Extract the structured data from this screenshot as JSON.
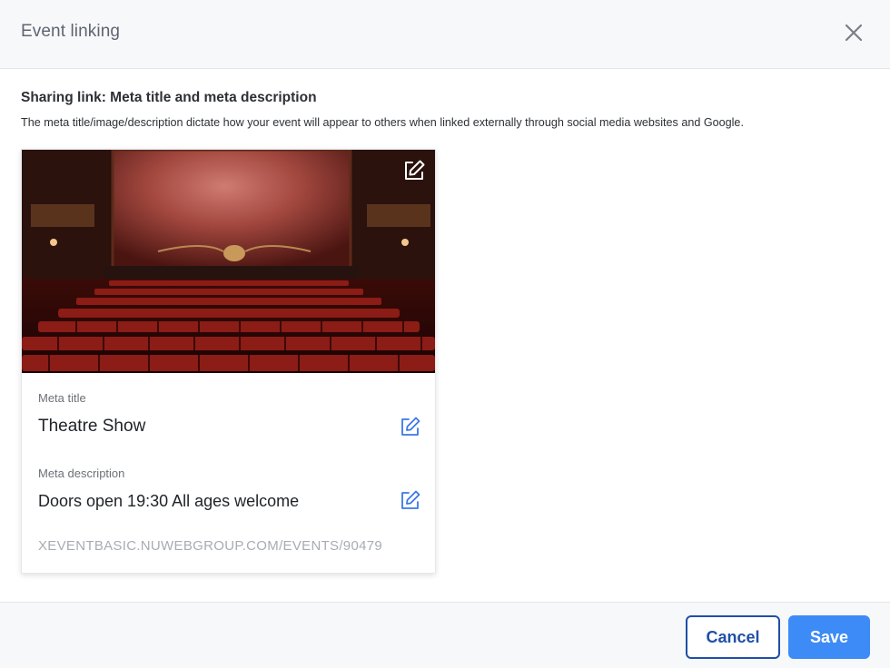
{
  "header": {
    "title": "Event linking",
    "close_icon": "close-icon"
  },
  "section": {
    "title": "Sharing link: Meta title and meta description",
    "description": "The meta title/image/description dictate how your event will appear to others when linked externally through social media websites and Google."
  },
  "card": {
    "image_description": "theatre-auditorium-photo",
    "image_edit_icon": "edit-icon",
    "meta_title_label": "Meta title",
    "meta_title_value": "Theatre Show",
    "meta_description_label": "Meta description",
    "meta_description_value": "Doors open 19:30 All ages welcome",
    "url": "XEVENTBASIC.NUWEBGROUP.COM/EVENTS/90479"
  },
  "footer": {
    "cancel_label": "Cancel",
    "save_label": "Save"
  },
  "colors": {
    "primary": "#3d8bf7",
    "secondary_border": "#1f4fa8",
    "edit_icon_blue": "#3b78e7"
  }
}
